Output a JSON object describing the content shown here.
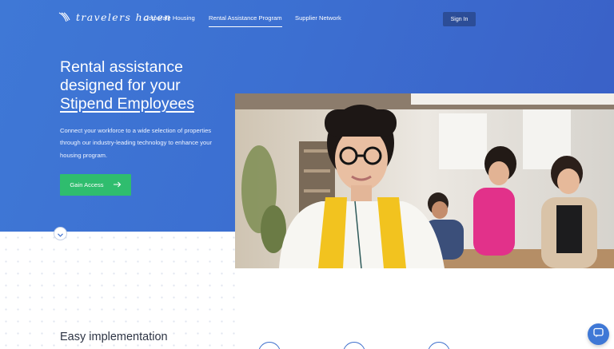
{
  "brand": {
    "logo_text": "travelers haven"
  },
  "nav": {
    "links": [
      {
        "label": "Corporate Housing"
      },
      {
        "label": "Rental Assistance Program",
        "active": true
      },
      {
        "label": "Supplier Network"
      }
    ],
    "sign_in": "Sign In"
  },
  "hero": {
    "headline_line1": "Rental assistance",
    "headline_line2": "designed for your",
    "headline_highlight": "Stipend Employees",
    "subtext": "Connect your workforce to a wide selection of properties through our industry-leading technology to enhance your housing program.",
    "cta_label": "Gain Access",
    "cta_icon": "arrow-right-icon",
    "scroll_icon": "chevron-down-icon"
  },
  "photo": {
    "subject": "office-team-photo"
  },
  "section": {
    "title": "Easy implementation"
  },
  "chat": {
    "icon": "chat-bubble-icon"
  },
  "colors": {
    "hero_blue": "#3f78d6",
    "sign_in_bg": "#2c4d97",
    "cta_green": "#2fbd6e",
    "heading_dark": "#2d3444"
  }
}
